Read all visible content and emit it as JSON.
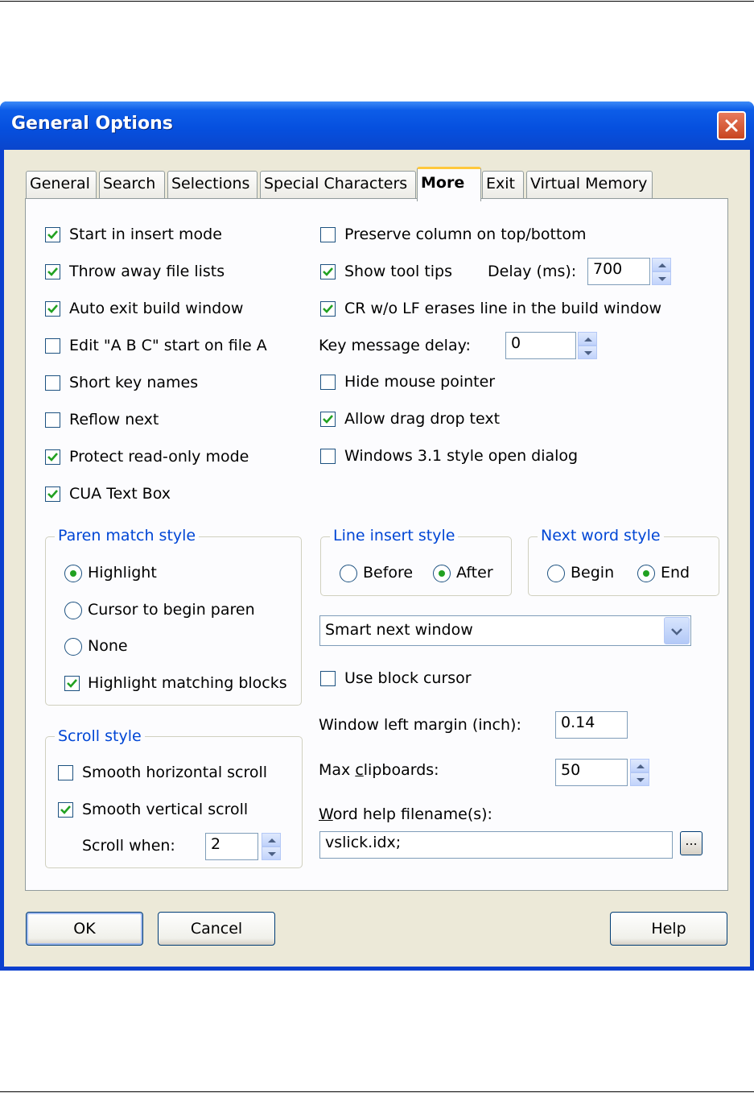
{
  "window": {
    "title": "General Options"
  },
  "tabs": [
    "General",
    "Search",
    "Selections",
    "Special Characters",
    "More",
    "Exit",
    "Virtual Memory"
  ],
  "active_tab": "More",
  "left_checks": [
    {
      "label": "Start in insert mode",
      "checked": true
    },
    {
      "label": "Throw away file lists",
      "checked": true
    },
    {
      "label": "Auto exit build window",
      "checked": true
    },
    {
      "label": "Edit \"A B C\" start on file A",
      "checked": false
    },
    {
      "label": "Short key names",
      "checked": false
    },
    {
      "label": "Reflow next",
      "checked": false
    },
    {
      "label": "Protect read-only mode",
      "checked": true
    },
    {
      "label": "CUA Text Box",
      "checked": true
    }
  ],
  "right_top": {
    "preserve_column": {
      "label": "Preserve column on top/bottom",
      "checked": false
    },
    "show_tool_tips": {
      "label": "Show tool tips",
      "checked": true
    },
    "delay_label": "Delay (ms):",
    "delay_value": "700",
    "cr_wo_lf": {
      "label": "CR w/o LF erases line in the build window",
      "checked": true
    },
    "key_delay_label": "Key message delay:",
    "key_delay_value": "0",
    "hide_mouse": {
      "label": "Hide mouse pointer",
      "checked": false
    },
    "allow_drag": {
      "label": "Allow drag drop text",
      "checked": true
    },
    "win31": {
      "label": "Windows 3.1 style open dialog",
      "checked": false
    }
  },
  "paren_match": {
    "title": "Paren match style",
    "options": [
      "Highlight",
      "Cursor to begin paren",
      "None"
    ],
    "selected": "Highlight",
    "highlight_blocks": {
      "label": "Highlight matching blocks",
      "checked": true
    }
  },
  "line_insert": {
    "title": "Line insert style",
    "options": [
      "Before",
      "After"
    ],
    "selected": "After"
  },
  "next_word": {
    "title": "Next word style",
    "options": [
      "Begin",
      "End"
    ],
    "selected": "End"
  },
  "next_window_combo": {
    "value": "Smart next window"
  },
  "use_block_cursor": {
    "label": "Use block cursor",
    "checked": false
  },
  "window_left_margin": {
    "label": "Window left margin (inch):",
    "value": "0.14"
  },
  "max_clipboards": {
    "label_pre": "Max ",
    "label_accel": "c",
    "label_post": "lipboards:",
    "value": "50"
  },
  "word_help": {
    "label_accel": "W",
    "label_post": "ord help filename(s):",
    "value": "vslick.idx;",
    "browse": "..."
  },
  "scroll_style": {
    "title": "Scroll style",
    "horizontal": {
      "label": "Smooth horizontal scroll",
      "checked": false
    },
    "vertical": {
      "label": "Smooth vertical scroll",
      "checked": true
    },
    "when_label": "Scroll when:",
    "when_value": "2"
  },
  "buttons": {
    "ok": "OK",
    "cancel": "Cancel",
    "help": "Help"
  }
}
